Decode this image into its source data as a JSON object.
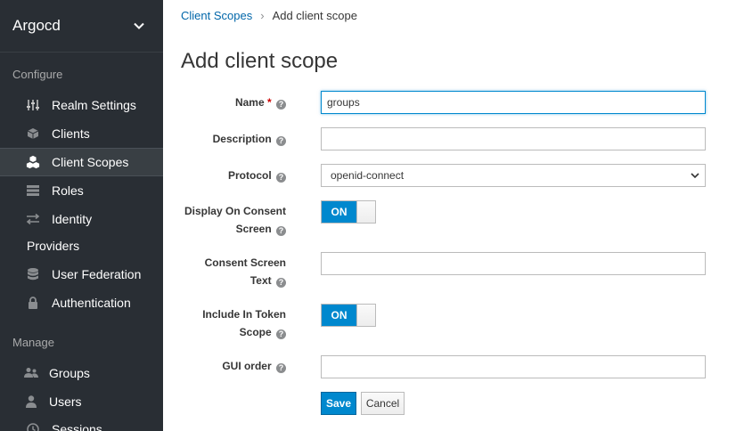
{
  "realm": {
    "name": "Argocd"
  },
  "sidebar": {
    "configure_label": "Configure",
    "manage_label": "Manage",
    "configure_items": [
      {
        "label": "Realm Settings",
        "icon": "sliders-icon"
      },
      {
        "label": "Clients",
        "icon": "cube-icon"
      },
      {
        "label": "Client Scopes",
        "icon": "cubes-icon",
        "active": true
      },
      {
        "label": "Roles",
        "icon": "list-icon"
      },
      {
        "label": "Identity",
        "label2": "Providers",
        "icon": "exchange-icon"
      },
      {
        "label": "User Federation",
        "icon": "database-icon"
      },
      {
        "label": "Authentication",
        "icon": "lock-icon"
      }
    ],
    "manage_items": [
      {
        "label": "Groups",
        "icon": "users-icon"
      },
      {
        "label": "Users",
        "icon": "user-icon"
      },
      {
        "label": "Sessions",
        "icon": "clock-icon"
      }
    ]
  },
  "breadcrumb": {
    "parent": "Client Scopes",
    "separator": "›",
    "current": "Add client scope"
  },
  "page": {
    "title": "Add client scope"
  },
  "form": {
    "name": {
      "label": "Name",
      "required_mark": "*",
      "value": "groups"
    },
    "description": {
      "label": "Description",
      "value": ""
    },
    "protocol": {
      "label": "Protocol",
      "value": "openid-connect"
    },
    "display_on_consent": {
      "label_line1": "Display On Consent",
      "label_line2": "Screen",
      "state": "ON"
    },
    "consent_text": {
      "label_line1": "Consent Screen",
      "label_line2": "Text",
      "value": ""
    },
    "include_in_token": {
      "label_line1": "Include In Token",
      "label_line2": "Scope",
      "state": "ON"
    },
    "gui_order": {
      "label": "GUI order",
      "value": ""
    },
    "help_glyph": "?",
    "save_label": "Save",
    "cancel_label": "Cancel"
  },
  "colors": {
    "accent": "#0088ce",
    "sidebar_bg": "#292e34",
    "link": "#0066a9",
    "required": "#cc0000"
  }
}
